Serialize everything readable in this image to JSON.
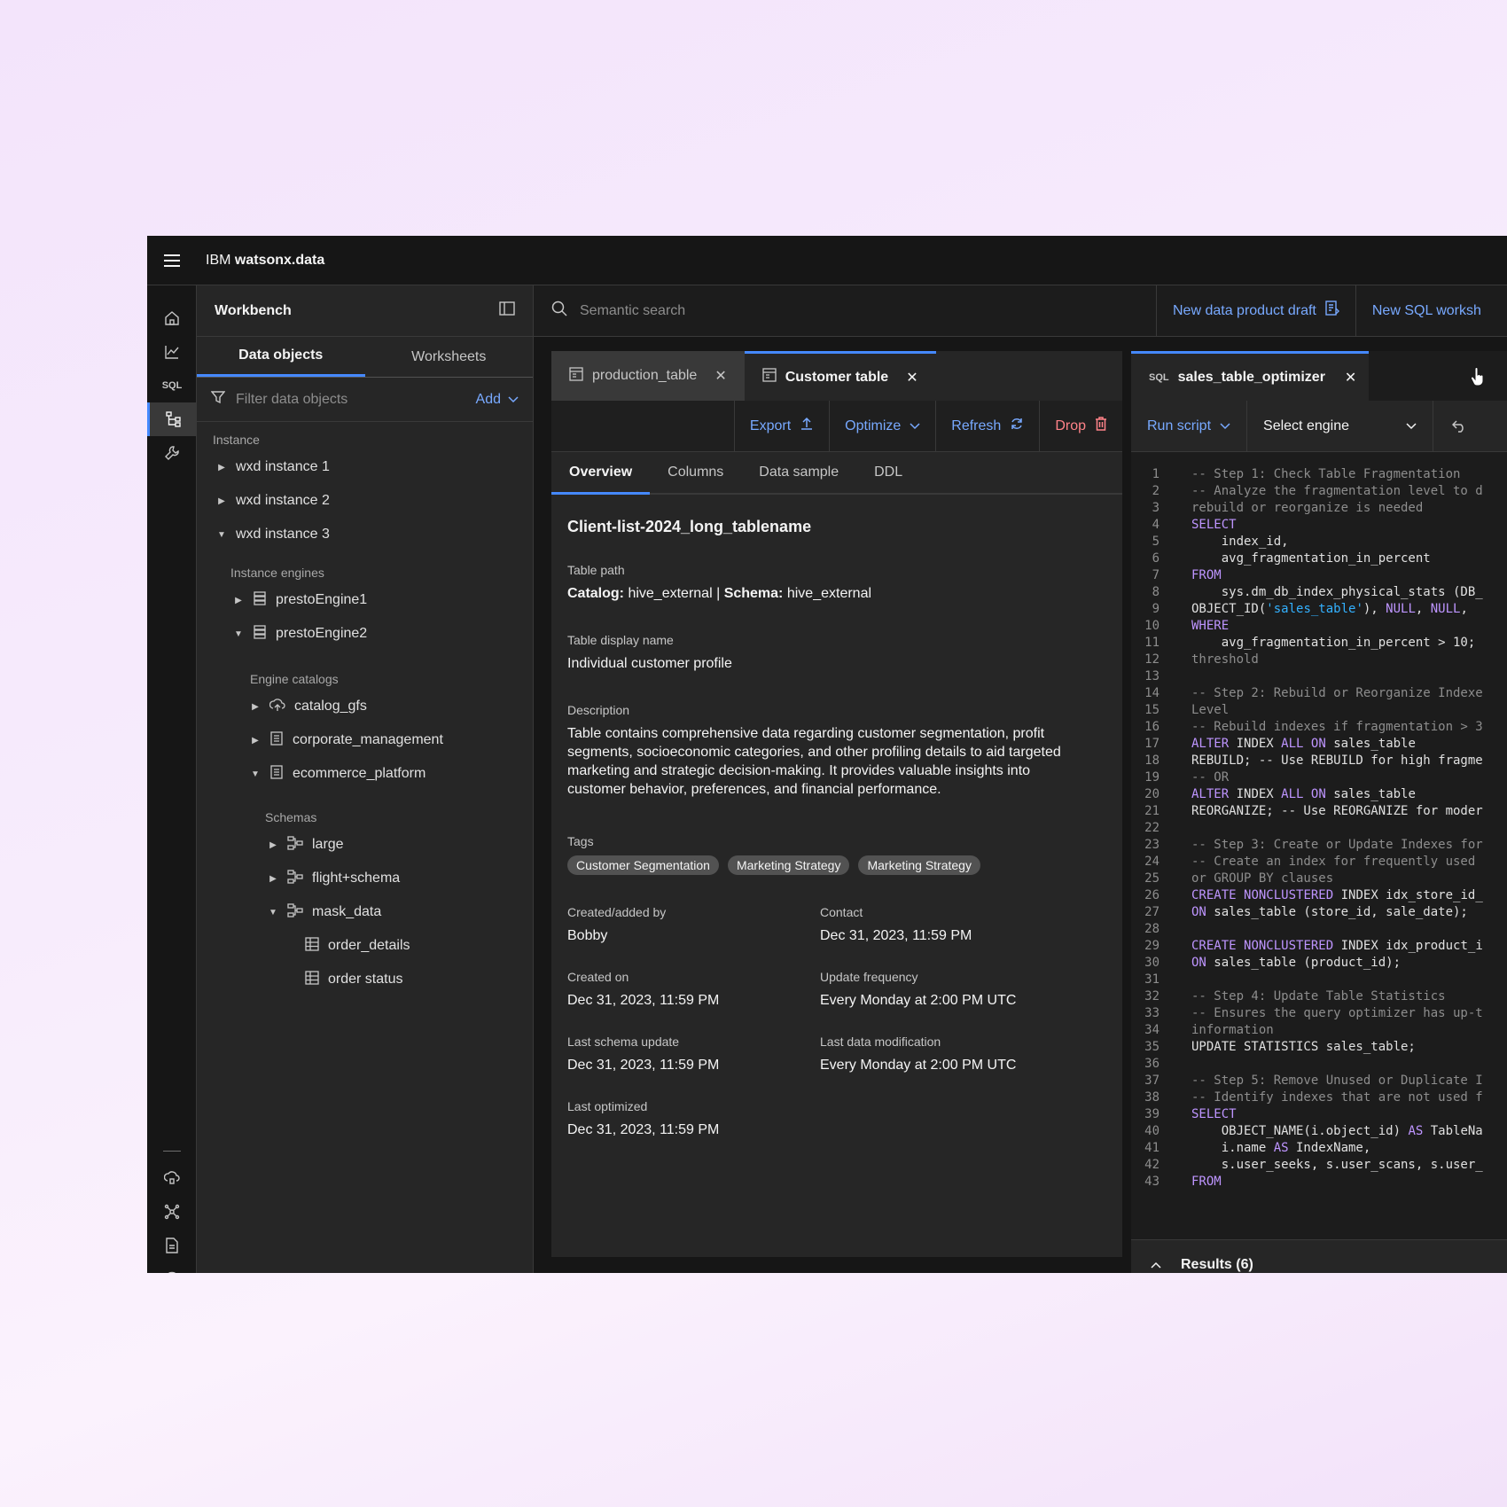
{
  "app": {
    "brand_prefix": "IBM",
    "brand_name": "watsonx.data"
  },
  "rail": {
    "sql_label": "SQL"
  },
  "sidebar": {
    "title": "Workbench",
    "tabs": [
      "Data objects",
      "Worksheets"
    ],
    "filter_placeholder": "Filter data objects",
    "add_label": "Add",
    "section_instance": "Instance",
    "instances": [
      "wxd instance 1",
      "wxd instance 2",
      "wxd instance 3"
    ],
    "section_engines": "Instance engines",
    "engines": [
      "prestoEngine1",
      "prestoEngine2"
    ],
    "section_catalogs": "Engine catalogs",
    "catalogs": [
      "catalog_gfs",
      "corporate_management",
      "ecommerce_platform"
    ],
    "section_schemas": "Schemas",
    "schemas": [
      "large",
      "flight+schema",
      "mask_data"
    ],
    "tables": [
      "order_details",
      "order status"
    ]
  },
  "search": {
    "placeholder": "Semantic search",
    "new_draft": "New data product draft",
    "new_sql": "New SQL worksh"
  },
  "main": {
    "tabs": [
      "production_table",
      "Customer table"
    ],
    "toolbar": {
      "export": "Export",
      "optimize": "Optimize",
      "refresh": "Refresh",
      "drop": "Drop"
    },
    "content_tabs": [
      "Overview",
      "Columns",
      "Data sample",
      "DDL"
    ],
    "table_name": "Client-list-2024_long_tablename",
    "path_label": "Table path",
    "catalog_key": "Catalog:",
    "catalog_value": "hive_external",
    "schema_key": "Schema:",
    "schema_value": "hive_external",
    "display_label": "Table display name",
    "display_value": "Individual customer profile",
    "desc_label": "Description",
    "desc_value": "Table contains comprehensive data regarding customer segmentation, profit segments, socioeconomic categories, and other profiling details to aid targeted marketing and strategic decision-making. It provides valuable insights into customer behavior, preferences, and financial performance.",
    "tags_label": "Tags",
    "tags": [
      "Customer Segmentation",
      "Marketing Strategy",
      "Marketing Strategy"
    ],
    "fields": [
      {
        "label": "Created/added by",
        "value": "Bobby"
      },
      {
        "label": "Contact",
        "value": "Dec 31, 2023, 11:59 PM"
      },
      {
        "label": "Created on",
        "value": "Dec 31, 2023, 11:59 PM"
      },
      {
        "label": "Update frequency",
        "value": "Every Monday at 2:00 PM UTC"
      },
      {
        "label": "Last schema update",
        "value": "Dec 31, 2023, 11:59 PM"
      },
      {
        "label": "Last data modification",
        "value": "Every Monday at 2:00 PM UTC"
      },
      {
        "label": "Last optimized",
        "value": "Dec 31, 2023, 11:59 PM"
      }
    ]
  },
  "sql": {
    "tab_badge": "SQL",
    "tab_title": "sales_table_optimizer",
    "run_label": "Run script",
    "engine_placeholder": "Select engine",
    "results_label": "Results (6)",
    "lines": [
      "-- Step 1: Check Table Fragmentation",
      "-- Analyze the fragmentation level to d",
      "rebuild or reorganize is needed",
      "SELECT",
      "    index_id,",
      "    avg_fragmentation_in_percent",
      "FROM",
      "    sys.dm_db_index_physical_stats (DB_",
      "OBJECT_ID('sales_table'), NULL, NULL, '",
      "WHERE",
      "    avg_fragmentation_in_percent > 10;",
      "threshold",
      "",
      "-- Step 2: Rebuild or Reorganize Indexe",
      "Level",
      "-- Rebuild indexes if fragmentation > 3",
      "ALTER INDEX ALL ON sales_table",
      "REBUILD; -- Use REBUILD for high fragme",
      "-- OR",
      "ALTER INDEX ALL ON sales_table",
      "REORGANIZE; -- Use REORGANIZE for moder",
      "",
      "-- Step 3: Create or Update Indexes for",
      "-- Create an index for frequently used",
      "or GROUP BY clauses",
      "CREATE NONCLUSTERED INDEX idx_store_id_",
      "ON sales_table (store_id, sale_date);",
      "",
      "CREATE NONCLUSTERED INDEX idx_product_i",
      "ON sales_table (product_id);",
      "",
      "-- Step 4: Update Table Statistics",
      "-- Ensures the query optimizer has up-t",
      "information",
      "UPDATE STATISTICS sales_table;",
      "",
      "-- Step 5: Remove Unused or Duplicate I",
      "-- Identify indexes that are not used f",
      "SELECT",
      "    OBJECT_NAME(i.object_id) AS TableNa",
      "    i.name AS IndexName,",
      "    s.user_seeks, s.user_scans, s.user_",
      "FROM"
    ]
  },
  "colors": {
    "accent": "#4589ff",
    "link": "#78a9ff",
    "danger": "#ff8389",
    "keyword": "#be95ff",
    "string": "#33b1ff"
  }
}
